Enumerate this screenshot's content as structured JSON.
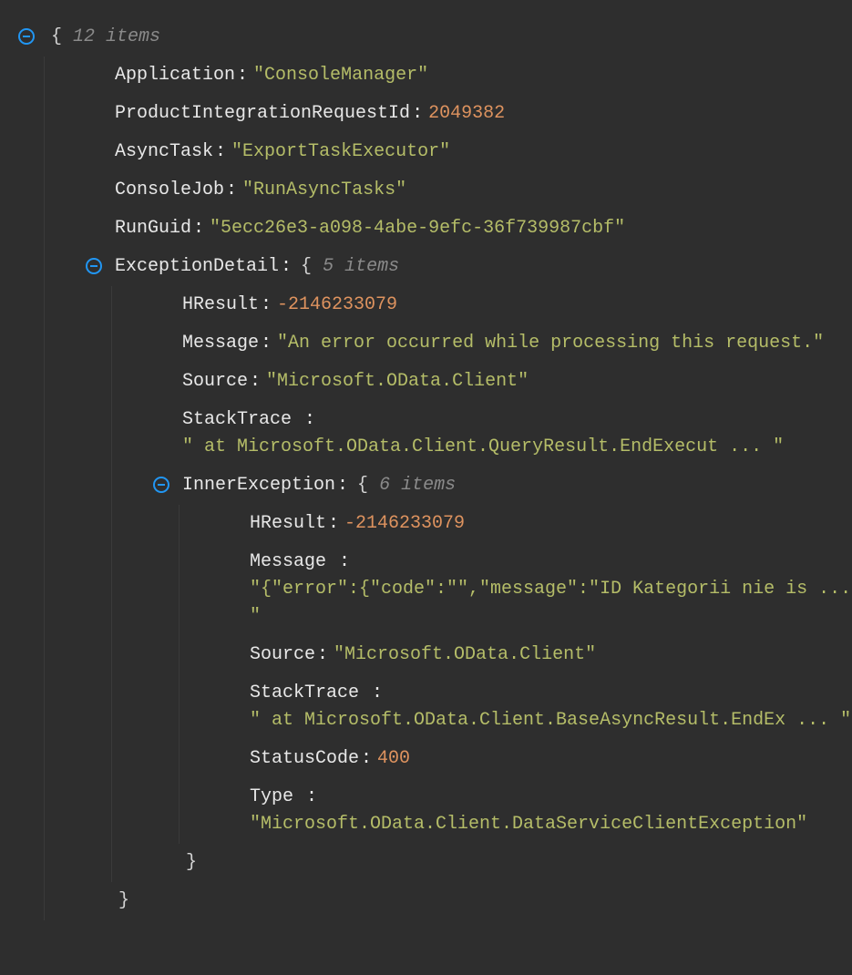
{
  "root": {
    "count": "12 items",
    "open": "{",
    "close": "}"
  },
  "application": {
    "key": "Application",
    "value": "\"ConsoleManager\""
  },
  "pir": {
    "key": "ProductIntegrationRequestId",
    "value": "2049382"
  },
  "asyncTask": {
    "key": "AsyncTask",
    "value": "\"ExportTaskExecutor\""
  },
  "consoleJob": {
    "key": "ConsoleJob",
    "value": "\"RunAsyncTasks\""
  },
  "runGuid": {
    "key": "RunGuid",
    "value": "\"5ecc26e3-a098-4abe-9efc-36f739987cbf\""
  },
  "exception": {
    "key": "ExceptionDetail",
    "count": "5 items",
    "hresult": {
      "key": "HResult",
      "value": "-2146233079"
    },
    "message": {
      "key": "Message",
      "value": "\"An error occurred while processing this request.\""
    },
    "source": {
      "key": "Source",
      "value": "\"Microsoft.OData.Client\""
    },
    "stack": {
      "key": "StackTrace",
      "value": "\" at Microsoft.OData.Client.QueryResult.EndExecut ... \""
    },
    "inner": {
      "key": "InnerException",
      "count": "6 items",
      "hresult": {
        "key": "HResult",
        "value": "-2146233079"
      },
      "message": {
        "key": "Message",
        "value": "\"{\"error\":{\"code\":\"\",\"message\":\"ID Kategorii nie is ... \""
      },
      "source": {
        "key": "Source",
        "value": "\"Microsoft.OData.Client\""
      },
      "stack": {
        "key": "StackTrace",
        "value": "\" at Microsoft.OData.Client.BaseAsyncResult.EndEx ... \""
      },
      "status": {
        "key": "StatusCode",
        "value": "400"
      },
      "type": {
        "key": "Type",
        "value": "\"Microsoft.OData.Client.DataServiceClientException\""
      }
    }
  }
}
